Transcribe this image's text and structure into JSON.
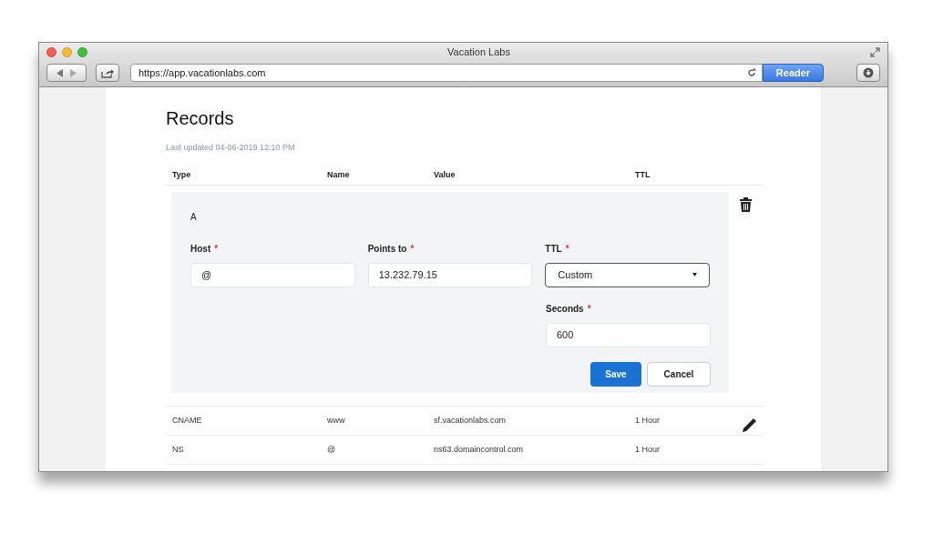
{
  "window": {
    "title": "Vacation Labs",
    "url": "https://app.vacationlabs.com",
    "reader_button": "Reader"
  },
  "page": {
    "title": "Records",
    "last_updated": "Last updated 04-06-2019 12:10 PM"
  },
  "table": {
    "columns": [
      "Type",
      "Name",
      "Value",
      "TTL"
    ],
    "editor": {
      "type": "A",
      "required_marker": "*",
      "fields": [
        {
          "kind": "input",
          "label": "Host",
          "required": true,
          "value": "@"
        },
        {
          "kind": "input",
          "label": "Points to",
          "required": true,
          "value": "13.232.79.15"
        },
        {
          "kind": "select",
          "label": "TTL",
          "required": true,
          "value": "Custom"
        }
      ],
      "seconds": {
        "label": "Seconds",
        "required": true,
        "value": "600"
      },
      "buttons": [
        {
          "kind": "primary",
          "label": "Save"
        },
        {
          "kind": "secondary",
          "label": "Cancel"
        }
      ]
    },
    "rows": [
      {
        "type": "CNAME",
        "name": "www",
        "value": "sf.vacationlabs.com",
        "ttl": "1 Hour"
      },
      {
        "type": "NS",
        "name": "@",
        "value": "ns63.domaincontrol.com",
        "ttl": "1 Hour"
      }
    ]
  }
}
